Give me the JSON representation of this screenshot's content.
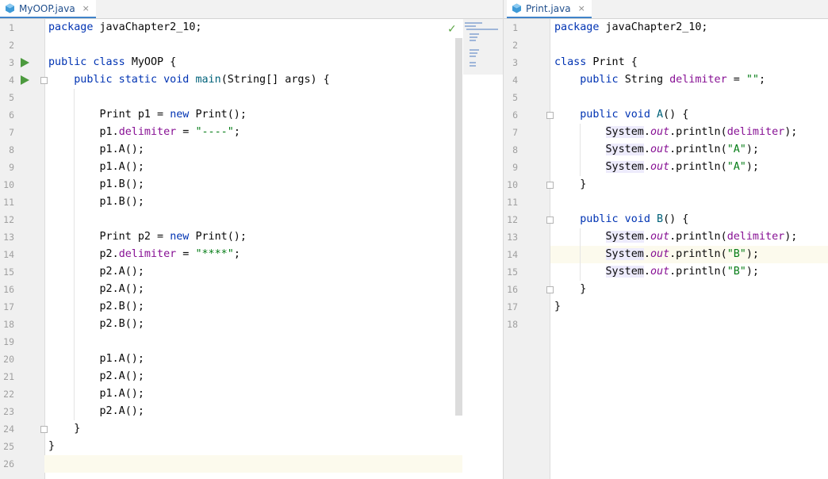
{
  "left_editor": {
    "tab": {
      "label": "MyOOP.java",
      "close": "×"
    },
    "lines": [
      {
        "n": "1",
        "toks": [
          {
            "t": "package ",
            "c": "kw"
          },
          {
            "t": "javaChapter2_10;",
            "c": ""
          }
        ]
      },
      {
        "n": "2",
        "toks": []
      },
      {
        "n": "3",
        "toks": [
          {
            "t": "public class ",
            "c": "kw"
          },
          {
            "t": "MyOOP {",
            "c": ""
          }
        ]
      },
      {
        "n": "4",
        "toks": [
          {
            "t": "    public static void ",
            "c": "kw"
          },
          {
            "t": "main",
            "c": "fn"
          },
          {
            "t": "(String[] args) {",
            "c": ""
          }
        ]
      },
      {
        "n": "5",
        "toks": []
      },
      {
        "n": "6",
        "toks": [
          {
            "t": "        Print p1 = ",
            "c": ""
          },
          {
            "t": "new ",
            "c": "kw"
          },
          {
            "t": "Print();",
            "c": ""
          }
        ]
      },
      {
        "n": "7",
        "toks": [
          {
            "t": "        p1.",
            "c": ""
          },
          {
            "t": "delimiter",
            "c": "fld"
          },
          {
            "t": " = ",
            "c": ""
          },
          {
            "t": "\"----\"",
            "c": "str"
          },
          {
            "t": ";",
            "c": ""
          }
        ]
      },
      {
        "n": "8",
        "toks": [
          {
            "t": "        p1.A();",
            "c": ""
          }
        ]
      },
      {
        "n": "9",
        "toks": [
          {
            "t": "        p1.A();",
            "c": ""
          }
        ]
      },
      {
        "n": "10",
        "toks": [
          {
            "t": "        p1.B();",
            "c": ""
          }
        ]
      },
      {
        "n": "11",
        "toks": [
          {
            "t": "        p1.B();",
            "c": ""
          }
        ]
      },
      {
        "n": "12",
        "toks": []
      },
      {
        "n": "13",
        "toks": [
          {
            "t": "        Print p2 = ",
            "c": ""
          },
          {
            "t": "new ",
            "c": "kw"
          },
          {
            "t": "Print();",
            "c": ""
          }
        ]
      },
      {
        "n": "14",
        "toks": [
          {
            "t": "        p2.",
            "c": ""
          },
          {
            "t": "delimiter",
            "c": "fld"
          },
          {
            "t": " = ",
            "c": ""
          },
          {
            "t": "\"****\"",
            "c": "str"
          },
          {
            "t": ";",
            "c": ""
          }
        ]
      },
      {
        "n": "15",
        "toks": [
          {
            "t": "        p2.A();",
            "c": ""
          }
        ]
      },
      {
        "n": "16",
        "toks": [
          {
            "t": "        p2.A();",
            "c": ""
          }
        ]
      },
      {
        "n": "17",
        "toks": [
          {
            "t": "        p2.B();",
            "c": ""
          }
        ]
      },
      {
        "n": "18",
        "toks": [
          {
            "t": "        p2.B();",
            "c": ""
          }
        ]
      },
      {
        "n": "19",
        "toks": []
      },
      {
        "n": "20",
        "toks": [
          {
            "t": "        p1.A();",
            "c": ""
          }
        ]
      },
      {
        "n": "21",
        "toks": [
          {
            "t": "        p2.A();",
            "c": ""
          }
        ]
      },
      {
        "n": "22",
        "toks": [
          {
            "t": "        p1.A();",
            "c": ""
          }
        ]
      },
      {
        "n": "23",
        "toks": [
          {
            "t": "        p2.A();",
            "c": ""
          }
        ]
      },
      {
        "n": "24",
        "toks": [
          {
            "t": "    }",
            "c": ""
          }
        ]
      },
      {
        "n": "25",
        "toks": [
          {
            "t": "}",
            "c": ""
          }
        ]
      },
      {
        "n": "26",
        "toks": []
      }
    ]
  },
  "right_editor": {
    "tab": {
      "label": "Print.java",
      "close": "×"
    },
    "lines": [
      {
        "n": "1",
        "toks": [
          {
            "t": "package ",
            "c": "kw"
          },
          {
            "t": "javaChapter2_10;",
            "c": ""
          }
        ]
      },
      {
        "n": "2",
        "toks": []
      },
      {
        "n": "3",
        "toks": [
          {
            "t": "class ",
            "c": "kw"
          },
          {
            "t": "Print {",
            "c": ""
          }
        ]
      },
      {
        "n": "4",
        "toks": [
          {
            "t": "    public ",
            "c": "kw"
          },
          {
            "t": "String ",
            "c": ""
          },
          {
            "t": "delimiter",
            "c": "fld"
          },
          {
            "t": " = ",
            "c": ""
          },
          {
            "t": "\"\"",
            "c": "str"
          },
          {
            "t": ";",
            "c": ""
          }
        ]
      },
      {
        "n": "5",
        "toks": []
      },
      {
        "n": "6",
        "toks": [
          {
            "t": "    public void ",
            "c": "kw"
          },
          {
            "t": "A",
            "c": "fn"
          },
          {
            "t": "() {",
            "c": ""
          }
        ]
      },
      {
        "n": "7",
        "toks": [
          {
            "t": "        ",
            "c": ""
          },
          {
            "t": "System",
            "c": "cls-hl"
          },
          {
            "t": ".",
            "c": ""
          },
          {
            "t": "out",
            "c": "ital"
          },
          {
            "t": ".println(",
            "c": ""
          },
          {
            "t": "delimiter",
            "c": "fld"
          },
          {
            "t": ");",
            "c": ""
          }
        ]
      },
      {
        "n": "8",
        "toks": [
          {
            "t": "        ",
            "c": ""
          },
          {
            "t": "System",
            "c": "cls-hl"
          },
          {
            "t": ".",
            "c": ""
          },
          {
            "t": "out",
            "c": "ital"
          },
          {
            "t": ".println(",
            "c": ""
          },
          {
            "t": "\"A\"",
            "c": "str"
          },
          {
            "t": ");",
            "c": ""
          }
        ]
      },
      {
        "n": "9",
        "toks": [
          {
            "t": "        ",
            "c": ""
          },
          {
            "t": "System",
            "c": "cls-hl"
          },
          {
            "t": ".",
            "c": ""
          },
          {
            "t": "out",
            "c": "ital"
          },
          {
            "t": ".println(",
            "c": ""
          },
          {
            "t": "\"A\"",
            "c": "str"
          },
          {
            "t": ");",
            "c": ""
          }
        ]
      },
      {
        "n": "10",
        "toks": [
          {
            "t": "    }",
            "c": ""
          }
        ]
      },
      {
        "n": "11",
        "toks": []
      },
      {
        "n": "12",
        "toks": [
          {
            "t": "    public void ",
            "c": "kw"
          },
          {
            "t": "B",
            "c": "fn"
          },
          {
            "t": "() {",
            "c": ""
          }
        ]
      },
      {
        "n": "13",
        "toks": [
          {
            "t": "        ",
            "c": ""
          },
          {
            "t": "System",
            "c": "cls-hl"
          },
          {
            "t": ".",
            "c": ""
          },
          {
            "t": "out",
            "c": "ital"
          },
          {
            "t": ".println(",
            "c": ""
          },
          {
            "t": "delimiter",
            "c": "fld"
          },
          {
            "t": ");",
            "c": ""
          }
        ]
      },
      {
        "n": "14",
        "toks": [
          {
            "t": "        ",
            "c": ""
          },
          {
            "t": "System",
            "c": "cls-hl"
          },
          {
            "t": ".",
            "c": ""
          },
          {
            "t": "out",
            "c": "ital"
          },
          {
            "t": ".println(",
            "c": ""
          },
          {
            "t": "\"B\"",
            "c": "str"
          },
          {
            "t": ");",
            "c": ""
          }
        ]
      },
      {
        "n": "15",
        "toks": [
          {
            "t": "        ",
            "c": ""
          },
          {
            "t": "System",
            "c": "cls-hl"
          },
          {
            "t": ".",
            "c": ""
          },
          {
            "t": "out",
            "c": "ital"
          },
          {
            "t": ".println(",
            "c": ""
          },
          {
            "t": "\"B\"",
            "c": "str"
          },
          {
            "t": ");",
            "c": ""
          }
        ]
      },
      {
        "n": "16",
        "toks": [
          {
            "t": "    }",
            "c": ""
          }
        ]
      },
      {
        "n": "17",
        "toks": [
          {
            "t": "}",
            "c": ""
          }
        ]
      },
      {
        "n": "18",
        "toks": []
      }
    ]
  },
  "colors": {
    "keyword": "#0033b3",
    "string": "#067d17",
    "field": "#871094",
    "method": "#00627a",
    "run_gutter": "#4c9a3e",
    "current_line": "#fcfaed"
  },
  "icons": {
    "file": "java-class-file-icon",
    "run": "run-icon",
    "fold": "fold-icon",
    "inspection_ok": "check-icon"
  }
}
